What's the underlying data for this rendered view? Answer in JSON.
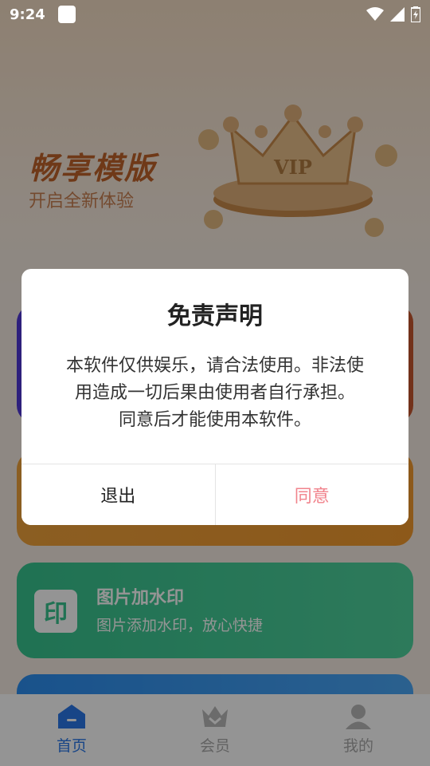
{
  "status_bar": {
    "time": "9:24"
  },
  "banner": {
    "title": "畅享模版",
    "subtitle": "开启全新体验",
    "crown_label": "VIP"
  },
  "cards": {
    "watermark": {
      "title": "图片加水印",
      "subtitle": "图片添加水印，放心快捷",
      "icon_glyph": "印"
    }
  },
  "bottom_nav": {
    "items": [
      {
        "label": "首页",
        "icon": "home-icon",
        "active": true
      },
      {
        "label": "会员",
        "icon": "crown-icon",
        "active": false
      },
      {
        "label": "我的",
        "icon": "profile-icon",
        "active": false
      }
    ]
  },
  "dialog": {
    "title": "免责声明",
    "body_lines": [
      "本软件仅供娱乐，请合法使用。非法使",
      "用造成一切后果由使用者自行承担。",
      "同意后才能使用本软件。"
    ],
    "exit_label": "退出",
    "agree_label": "同意"
  },
  "colors": {
    "primary_blue": "#2a78e8",
    "agree_pink": "#f1838c",
    "card_green": "#37c48f",
    "banner_orange": "#c0622a"
  }
}
